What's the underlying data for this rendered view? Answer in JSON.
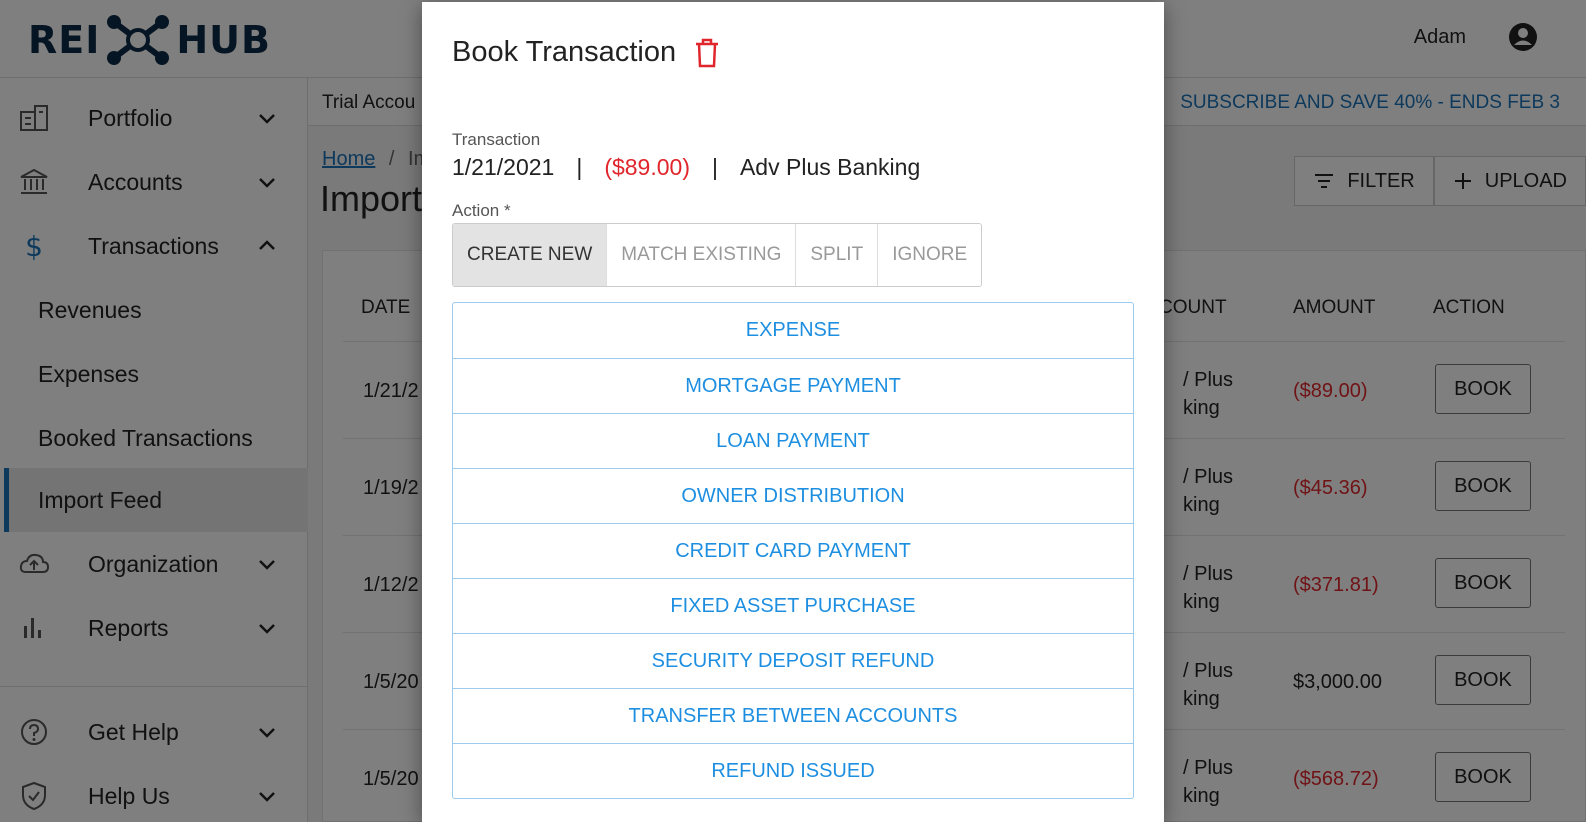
{
  "header": {
    "logo_left": "REI",
    "logo_right": "HUB",
    "user_name": "Adam"
  },
  "sidebar": {
    "items": [
      {
        "label": "Portfolio",
        "icon": "building-icon"
      },
      {
        "label": "Accounts",
        "icon": "bank-icon"
      },
      {
        "label": "Transactions",
        "icon": "dollar-icon"
      },
      {
        "label": "Organization",
        "icon": "cloud-upload-icon"
      },
      {
        "label": "Reports",
        "icon": "bar-chart-icon"
      },
      {
        "label": "Get Help",
        "icon": "help-circle-icon"
      },
      {
        "label": "Help Us",
        "icon": "shield-icon"
      }
    ],
    "sub_items": [
      "Revenues",
      "Expenses",
      "Booked Transactions",
      "Import Feed"
    ]
  },
  "main": {
    "trial_text": "Trial Accou",
    "subscribe": "SUBSCRIBE AND SAVE 40% - ENDS FEB 3",
    "breadcrumb_home": "Home",
    "breadcrumb_sep": "/",
    "breadcrumb_current": "Im",
    "page_title": "Import",
    "filter_label": "FILTER",
    "upload_label": "UPLOAD",
    "columns": {
      "date": "DATE",
      "account": "COUNT",
      "amount": "AMOUNT",
      "action": "ACTION"
    },
    "rows": [
      {
        "date": "1/21/2",
        "acct1": "/ Plus",
        "acct2": "king",
        "amount": "($89.00)",
        "negative": true,
        "book": "BOOK"
      },
      {
        "date": "1/19/2",
        "acct1": "/ Plus",
        "acct2": "king",
        "amount": "($45.36)",
        "negative": true,
        "book": "BOOK"
      },
      {
        "date": "1/12/2",
        "acct1": "/ Plus",
        "acct2": "king",
        "amount": "($371.81)",
        "negative": true,
        "book": "BOOK"
      },
      {
        "date": "1/5/20",
        "acct1": "/ Plus",
        "acct2": "king",
        "amount": "$3,000.00",
        "negative": false,
        "book": "BOOK"
      },
      {
        "date": "1/5/20",
        "acct1": "/ Plus",
        "acct2": "king",
        "amount": "($568.72)",
        "negative": true,
        "book": "BOOK"
      }
    ]
  },
  "modal": {
    "title": "Book Transaction",
    "transaction_label": "Transaction",
    "txn_date": "1/21/2021",
    "separator": "|",
    "txn_amount": "($89.00)",
    "txn_account": "Adv Plus Banking",
    "action_label": "Action *",
    "action_tabs": [
      "CREATE NEW",
      "MATCH EXISTING",
      "SPLIT",
      "IGNORE"
    ],
    "selected_tab": "CREATE NEW",
    "options": [
      "EXPENSE",
      "MORTGAGE PAYMENT",
      "LOAN PAYMENT",
      "OWNER DISTRIBUTION",
      "CREDIT CARD PAYMENT",
      "FIXED ASSET PURCHASE",
      "SECURITY DEPOSIT REFUND",
      "TRANSFER BETWEEN ACCOUNTS",
      "REFUND ISSUED"
    ]
  },
  "colors": {
    "accent": "#1a73b8",
    "option_blue": "#1e8fe0",
    "negative_red": "#e0262c",
    "logo_navy": "#0d2a47"
  }
}
